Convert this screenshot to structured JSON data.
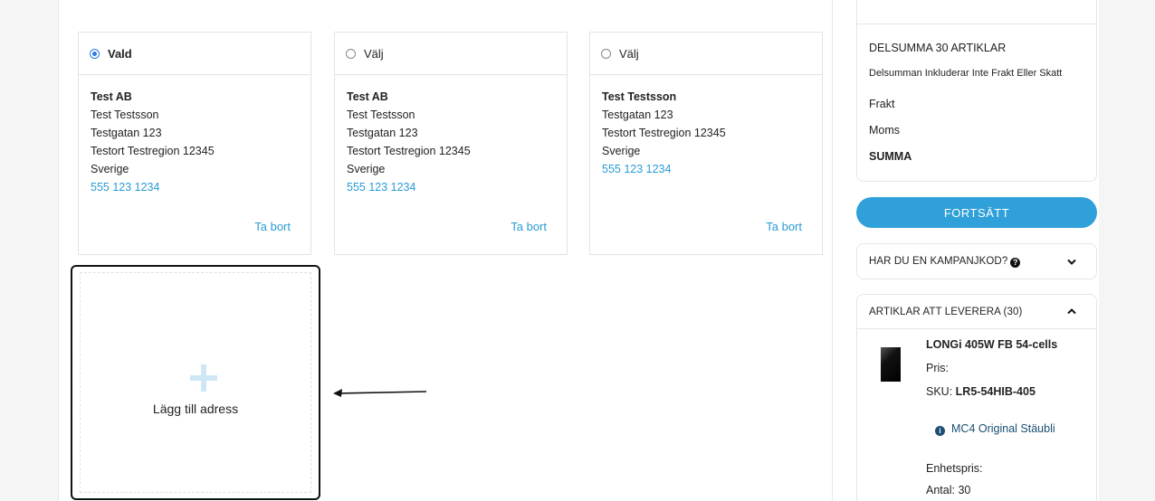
{
  "addresses": [
    {
      "state": "Vald",
      "selected": true,
      "lines": [
        "Test AB",
        "Test Testsson",
        "Testgatan 123",
        "Testort Testregion 12345",
        "Sverige"
      ],
      "phone": "555 123 1234",
      "remove": "Ta bort"
    },
    {
      "state": "Välj",
      "selected": false,
      "lines": [
        "Test AB",
        "Test Testsson",
        "Testgatan 123",
        "Testort Testregion 12345",
        "Sverige"
      ],
      "phone": "555 123 1234",
      "remove": "Ta bort"
    },
    {
      "state": "Välj",
      "selected": false,
      "lines": [
        "Test Testsson",
        "Testgatan 123",
        "Testort Testregion 12345",
        "Sverige"
      ],
      "phone": "555 123 1234",
      "remove": "Ta bort"
    }
  ],
  "add_address": {
    "label": "Lägg till adress",
    "icon": "plus-icon"
  },
  "summary": {
    "subtotal_label": "DELSUMMA 30 ARTIKLAR",
    "subtotal_note": "Delsumman Inkluderar Inte Frakt Eller Skatt",
    "shipping_label": "Frakt",
    "tax_label": "Moms",
    "total_label": "SUMMA"
  },
  "continue_button": "FORTSÄTT",
  "promo": {
    "label": "HAR DU EN KAMPANJKOD?",
    "icon": "help-icon"
  },
  "items": {
    "header": "ARTIKLAR ATT LEVERERA (30)",
    "product": {
      "name": "LONGi 405W FB 54-cells",
      "price_label": "Pris:",
      "sku_label": "SKU:",
      "sku": "LR5-54HIB-405",
      "option": "MC4 Original Stäubli",
      "unit_price_label": "Enhetspris:",
      "qty_label": "Antal:",
      "qty": "30"
    }
  },
  "colors": {
    "accent": "#2fa0da",
    "link": "#2b9bd6",
    "radio": "#2d7be5"
  }
}
